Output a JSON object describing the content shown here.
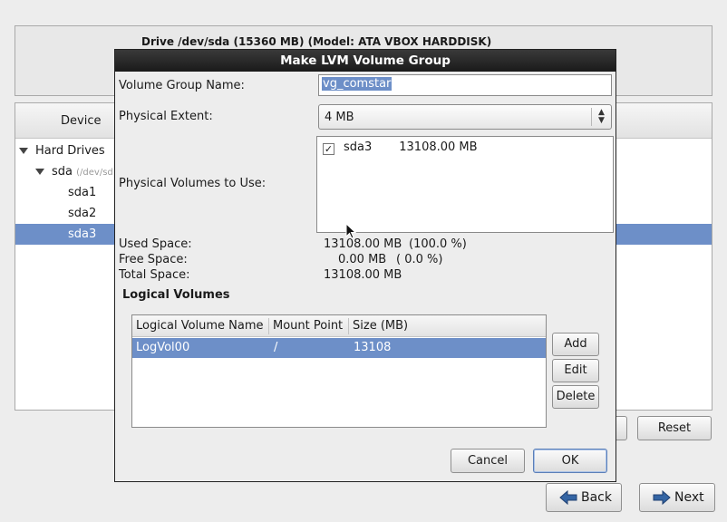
{
  "background": {
    "drive_title": "Drive /dev/sda (15360 MB) (Model: ATA VBOX HARDDISK)",
    "tree": {
      "header_device": "Device",
      "rows": [
        {
          "label": "Hard Drives",
          "sub": ""
        },
        {
          "label": "sda",
          "sub": "(/dev/sd"
        },
        {
          "label": "sda1",
          "sub": ""
        },
        {
          "label": "sda2",
          "sub": ""
        },
        {
          "label": "sda3",
          "sub": ""
        }
      ],
      "selected_index": 4
    },
    "reset_label": "Reset",
    "back_label": "Back",
    "next_label": "Next"
  },
  "dialog": {
    "title": "Make LVM Volume Group",
    "vg_name_label": "Volume Group Name:",
    "vg_name_value": "vg_comstar",
    "pe_label": "Physical Extent:",
    "pe_value": "4 MB",
    "pv_label": "Physical Volumes to Use:",
    "pv_items": [
      {
        "name": "sda3",
        "size": "13108.00 MB",
        "checked": true
      }
    ],
    "used_label": "Used Space:",
    "used_value": "13108.00 MB",
    "used_pct": "(100.0 %)",
    "free_label": "Free Space:",
    "free_value": "0.00 MB",
    "free_pct": "( 0.0 %)",
    "total_label": "Total Space:",
    "total_value": "13108.00 MB",
    "lv_section": "Logical Volumes",
    "lv_columns": [
      "Logical Volume Name",
      "Mount Point",
      "Size (MB)"
    ],
    "lv_rows": [
      {
        "name": "LogVol00",
        "mount": "/",
        "size": "13108"
      }
    ],
    "add_label": "Add",
    "edit_label": "Edit",
    "delete_label": "Delete",
    "cancel_label": "Cancel",
    "ok_label": "OK"
  }
}
